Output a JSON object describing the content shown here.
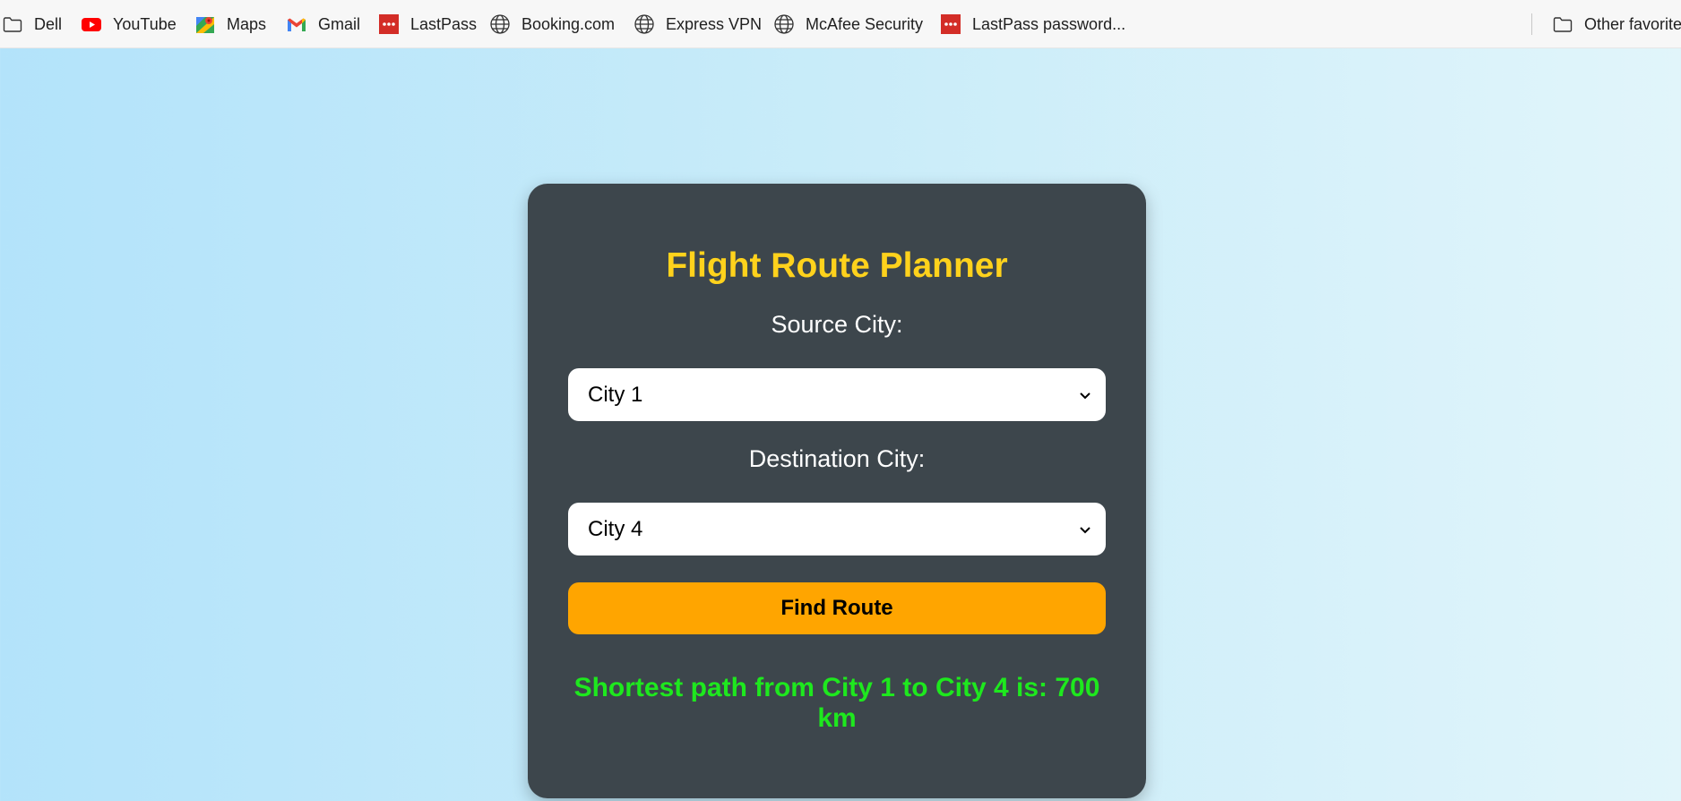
{
  "bookmarks": [
    {
      "label": "Dell",
      "icon": "folder-icon"
    },
    {
      "label": "YouTube",
      "icon": "youtube-icon"
    },
    {
      "label": "Maps",
      "icon": "maps-icon"
    },
    {
      "label": "Gmail",
      "icon": "gmail-icon"
    },
    {
      "label": "LastPass",
      "icon": "lastpass-icon"
    },
    {
      "label": "Booking.com",
      "icon": "globe-icon"
    },
    {
      "label": "Express VPN",
      "icon": "globe-icon"
    },
    {
      "label": "McAfee Security",
      "icon": "globe-icon"
    },
    {
      "label": "LastPass password...",
      "icon": "lastpass-icon"
    }
  ],
  "other_favorites": {
    "label": "Other favorite",
    "icon": "folder-icon"
  },
  "planner": {
    "title": "Flight Route Planner",
    "source_label": "Source City:",
    "source_value": "City 1",
    "destination_label": "Destination City:",
    "destination_value": "City 4",
    "find_button": "Find Route",
    "result": "Shortest path from City 1 to City 4 is: 700 km"
  },
  "colors": {
    "card_bg": "#3d464c",
    "title": "#ffd21c",
    "button": "#ffa500",
    "result": "#1ee81e",
    "page_bg_start": "#b3e3fa",
    "page_bg_end": "#e1f5fa"
  }
}
